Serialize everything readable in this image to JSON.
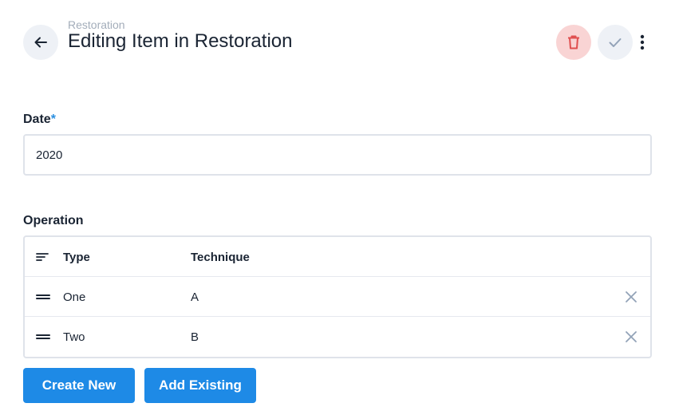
{
  "header": {
    "breadcrumb": "Restoration",
    "title": "Editing Item in Restoration",
    "icons": {
      "back": "arrow-left-icon",
      "delete": "trash-icon",
      "save": "check-icon",
      "more": "more-vertical-icon"
    },
    "colors": {
      "delete_bg": "#f9d4d4",
      "delete_icon": "#e05050",
      "neutral_bg": "#eef1f6"
    }
  },
  "date_field": {
    "label": "Date",
    "required_mark": "*",
    "value": "2020"
  },
  "operation": {
    "label": "Operation",
    "columns": [
      "Type",
      "Technique"
    ],
    "rows": [
      {
        "type": "One",
        "technique": "A"
      },
      {
        "type": "Two",
        "technique": "B"
      }
    ]
  },
  "actions": {
    "create_new": "Create New",
    "add_existing": "Add Existing",
    "accent": "#1e8ae6"
  }
}
